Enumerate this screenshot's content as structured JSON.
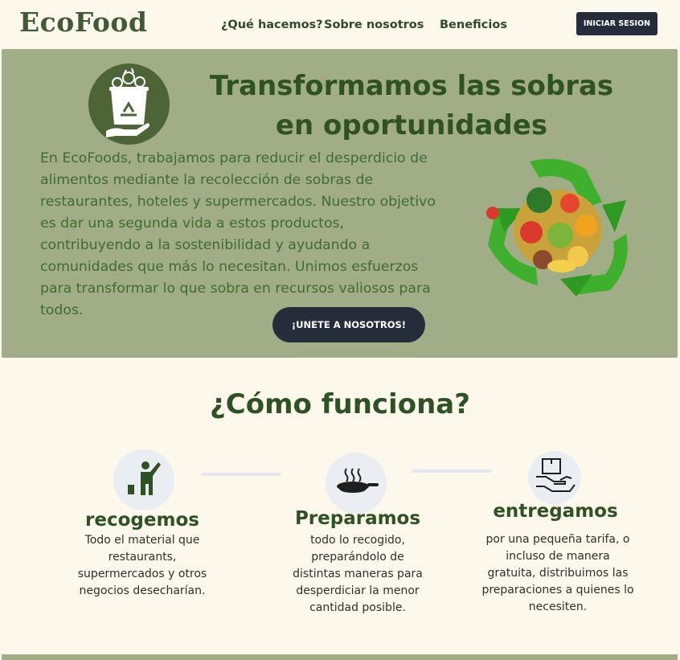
{
  "nav": {
    "logo": "EcoFood",
    "links": [
      "¿Qué hacemos?",
      "Sobre nosotros",
      "Beneficios"
    ],
    "login_label": "INICIAR SESION"
  },
  "hero": {
    "title_line1": "Transformamos las sobras",
    "title_line2": "en oportunidades",
    "text": "En EcoFoods, trabajamos para reducir el desperdicio de alimentos mediante la recolección de sobras de restaurantes, hoteles y supermercados. Nuestro objetivo es dar una segunda vida a estos productos, contribuyendo a la sostenibilidad y ayudando a comunidades que más lo necesitan. Unimos esfuerzos para transformar lo que sobra en recursos valiosos para todos.",
    "cta_label": "¡UNETE A NOSOTROS!",
    "icon": "recycle-bin-hand-icon",
    "image": "recycling-food-illustration"
  },
  "how": {
    "title": "¿Cómo funciona?",
    "steps": [
      {
        "icon": "person-raising-hand-icon",
        "title": "recogemos",
        "desc": "Todo el material que restaurants, supermercados y otros negocios desecharían."
      },
      {
        "icon": "frying-pan-icon",
        "title": "Preparamos",
        "desc": "todo lo recogido, preparándolo de distintas maneras para desperdiciar la menor cantidad posible."
      },
      {
        "icon": "delivery-hand-box-icon",
        "title": "entregamos",
        "desc": "por una pequeña tarifa, o incluso de manera gratuita, distribuimos las preparaciones a quienes lo necesiten."
      }
    ]
  },
  "colors": {
    "background": "#fdf8ec",
    "hero_bg": "#a1ad86",
    "primary_green": "#2f5224",
    "text_green": "#3f6d2e",
    "button_dark": "#262d3a"
  }
}
